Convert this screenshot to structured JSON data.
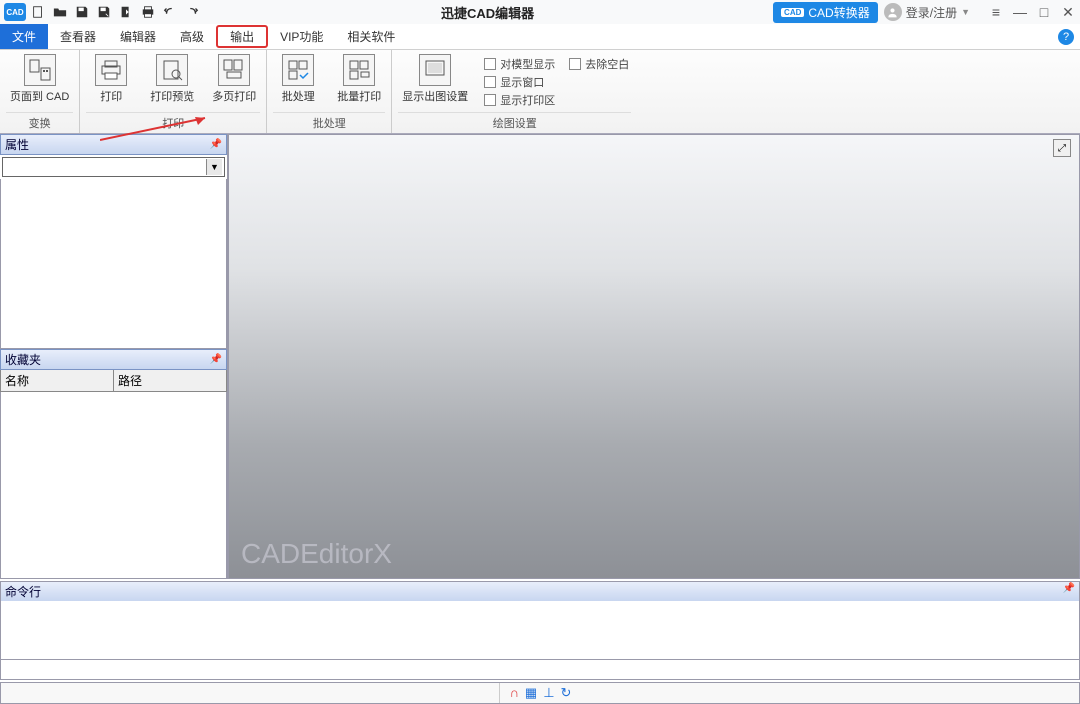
{
  "titlebar": {
    "app_logo_text": "CAD",
    "title": "迅捷CAD编辑器",
    "convert_btn_badge": "CAD",
    "convert_btn_label": "CAD转换器",
    "user_label": "登录/注册"
  },
  "menubar": {
    "items": [
      {
        "label": "文件",
        "active": true
      },
      {
        "label": "查看器"
      },
      {
        "label": "编辑器"
      },
      {
        "label": "高级"
      },
      {
        "label": "输出",
        "highlighted": true
      },
      {
        "label": "VIP功能"
      },
      {
        "label": "相关软件"
      }
    ],
    "help": "?"
  },
  "ribbon": {
    "groups": [
      {
        "label": "变换",
        "buttons": [
          {
            "label": "页面到 CAD",
            "name": "page-to-cad-button"
          }
        ]
      },
      {
        "label": "打印",
        "buttons": [
          {
            "label": "打印",
            "name": "print-button"
          },
          {
            "label": "打印预览",
            "name": "print-preview-button"
          },
          {
            "label": "多页打印",
            "name": "multi-page-print-button"
          }
        ]
      },
      {
        "label": "批处理",
        "buttons": [
          {
            "label": "批处理",
            "name": "batch-button"
          },
          {
            "label": "批量打印",
            "name": "batch-print-button"
          }
        ]
      },
      {
        "label": "绘图设置",
        "buttons": [
          {
            "label": "显示出图设置",
            "name": "plot-settings-button"
          }
        ],
        "checks_col1": [
          "对模型显示",
          "显示窗口",
          "显示打印区"
        ],
        "checks_col2": [
          "去除空白"
        ]
      }
    ]
  },
  "panels": {
    "properties_title": "属性",
    "favorites_title": "收藏夹",
    "fav_col1": "名称",
    "fav_col2": "路径"
  },
  "canvas": {
    "watermark": "CADEditorX"
  },
  "command": {
    "title": "命令行"
  }
}
